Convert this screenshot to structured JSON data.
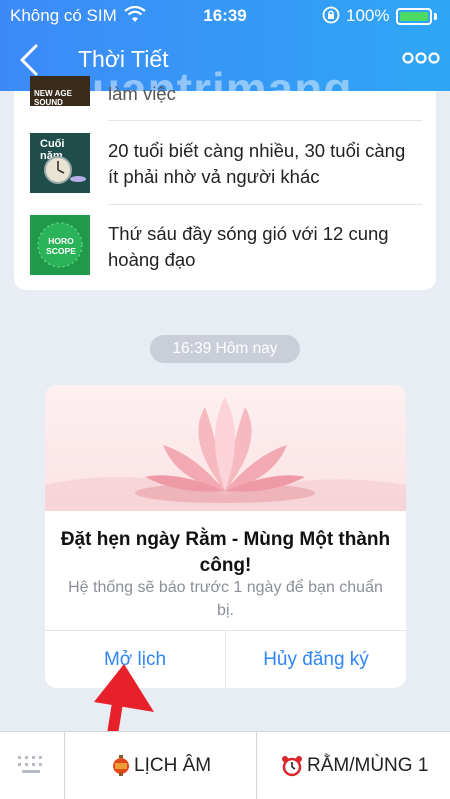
{
  "status_bar": {
    "carrier": "Không có SIM",
    "time": "16:39",
    "battery": "100%"
  },
  "nav": {
    "title": "Thời Tiết"
  },
  "watermark": "uantrimang",
  "articles": [
    {
      "thumb_label": "NEW AGE SOUND",
      "title": "làm việc"
    },
    {
      "thumb_label": "Cuối năm",
      "title": "20 tuổi biết càng nhiều, 30 tuổi càng ít phải nhờ vả người khác"
    },
    {
      "thumb_label": "HORO SCOPE",
      "title": "Thứ sáu đầy sóng gió với 12 cung hoàng đạo"
    }
  ],
  "timestamp": "16:39 Hôm nay",
  "event": {
    "title": "Đặt hẹn ngày Rằm - Mùng Một thành công!",
    "description": "Hệ thống sẽ báo trước 1 ngày để bạn chuẩn bị.",
    "open_label": "Mở lịch",
    "cancel_label": "Hủy đăng ký"
  },
  "bottom_menu": {
    "item1": "LỊCH ÂM",
    "item2": "RẰM/MÙNG 1"
  },
  "colors": {
    "header": "#3d8af7",
    "link": "#2f86f5",
    "arrow": "#e8202a"
  }
}
